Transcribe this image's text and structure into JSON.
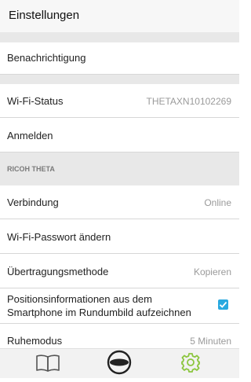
{
  "header": {
    "title": "Einstellungen"
  },
  "rows": {
    "notification": {
      "label": "Benachrichtigung"
    },
    "wifi_status": {
      "label": "Wi-Fi-Status",
      "value": "THETAXN10102269"
    },
    "login": {
      "label": "Anmelden"
    },
    "section": {
      "label": "RICOH THETA"
    },
    "connection": {
      "label": "Verbindung",
      "value": "Online"
    },
    "wifi_password": {
      "label": "Wi-Fi-Passwort ändern"
    },
    "transfer": {
      "label": "Übertragungsmethode",
      "value": "Kopieren"
    },
    "location": {
      "label_line1": "Positionsinformationen aus dem",
      "label_line2": "Smartphone im Rundumbild aufzeichnen",
      "checked": true
    },
    "sleep": {
      "label": "Ruhemodus",
      "value": "5 Minuten"
    }
  },
  "tabbar": {
    "items": [
      {
        "name": "book-icon",
        "active": false
      },
      {
        "name": "theta-camera-icon",
        "active": false
      },
      {
        "name": "gear-icon",
        "active": true
      }
    ],
    "active_color": "#8cc63f"
  }
}
